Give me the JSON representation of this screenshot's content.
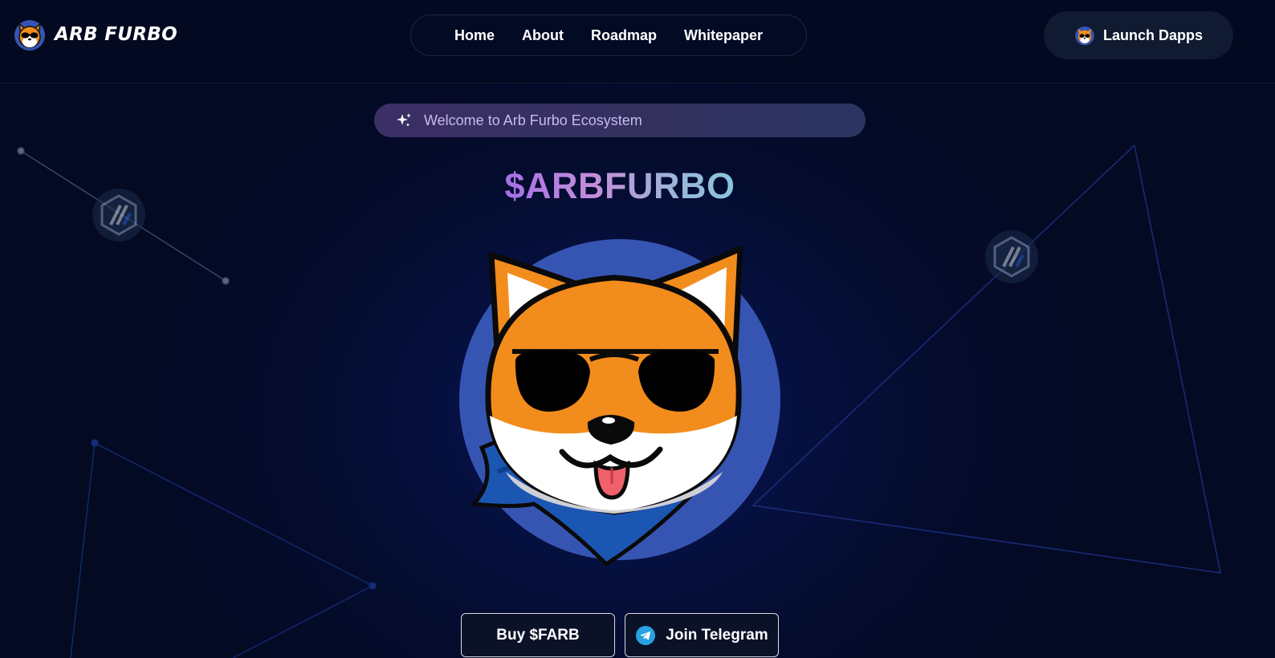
{
  "header": {
    "brand": "ARB FURBO",
    "nav": [
      {
        "label": "Home"
      },
      {
        "label": "About"
      },
      {
        "label": "Roadmap"
      },
      {
        "label": "Whitepaper"
      }
    ],
    "launch_label": "Launch Dapps"
  },
  "hero": {
    "welcome_text": "Welcome to Arb Furbo Ecosystem",
    "ticker": "$ARBFURBO",
    "buttons": {
      "buy_label": "Buy $FARB",
      "telegram_label": "Join Telegram"
    }
  },
  "icons": {
    "logo": "shiba-sunglasses-icon",
    "sparkle": "sparkles-icon",
    "telegram": "telegram-icon",
    "arbitrum": "arbitrum-icon"
  },
  "colors": {
    "background": "#030a22",
    "mascot_circle": "#3655b3",
    "orange": "#f28c1c",
    "pill": "#35305f",
    "telegram": "#2aa1e0"
  }
}
